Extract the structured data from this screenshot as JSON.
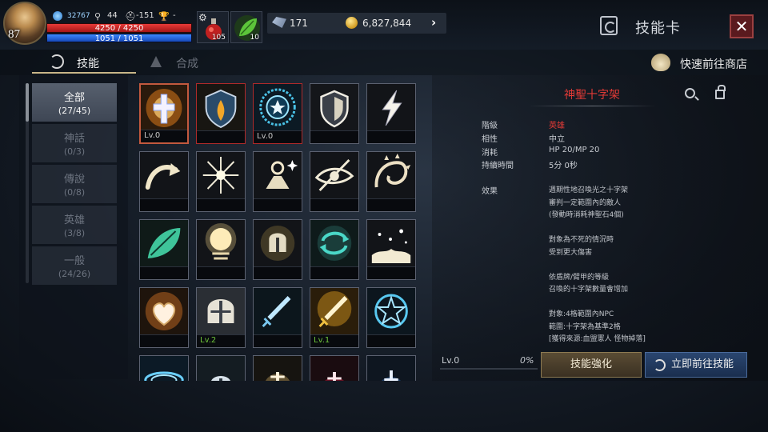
{
  "player": {
    "level": "87",
    "combat_power": "32767",
    "stat_a": "44",
    "stat_b": "-151",
    "stat_c": "-",
    "hp_text": "4250 / 4250",
    "mp_text": "1051 / 1051",
    "hp_fraction": 1.0,
    "mp_fraction": 1.0
  },
  "quick_slots": {
    "potion_count": "105",
    "leaf_count": "10"
  },
  "currency": {
    "crystal": "171",
    "gold": "6,827,844"
  },
  "header": {
    "title": "技能卡",
    "close_label": "✕"
  },
  "tabs": {
    "skill": "技能",
    "compose": "合成",
    "shop": "快速前往商店"
  },
  "categories": [
    {
      "name": "全部",
      "count": "(27/45)",
      "active": true
    },
    {
      "name": "神話",
      "count": "(0/3)",
      "active": false
    },
    {
      "name": "傳說",
      "count": "(0/8)",
      "active": false
    },
    {
      "name": "英雄",
      "count": "(3/8)",
      "active": false
    },
    {
      "name": "一般",
      "count": "(24/26)",
      "active": false
    }
  ],
  "skills": [
    {
      "icon": "holy-cross-icon",
      "level": "Lv.0",
      "border": "selected",
      "level_color": "#c8c8c8"
    },
    {
      "icon": "fire-shield-icon",
      "level": "",
      "border": "red",
      "level_color": "#c8c8c8"
    },
    {
      "icon": "star-ring-icon",
      "level": "Lv.0",
      "border": "red",
      "level_color": "#c8c8c8"
    },
    {
      "icon": "shield-icon",
      "level": "",
      "border": "normal",
      "level_color": "#c8c8c8"
    },
    {
      "icon": "lightning-icon",
      "level": "",
      "border": "normal",
      "level_color": "#c8c8c8"
    },
    {
      "icon": "curved-arrow-icon",
      "level": "",
      "border": "normal",
      "level_color": "#c8c8c8"
    },
    {
      "icon": "burst-icon",
      "level": "",
      "border": "normal",
      "level_color": "#c8c8c8"
    },
    {
      "icon": "sparkle-pyramid-icon",
      "level": "",
      "border": "normal",
      "level_color": "#c8c8c8"
    },
    {
      "icon": "eye-slash-icon",
      "level": "",
      "border": "normal",
      "level_color": "#c8c8c8"
    },
    {
      "icon": "thorn-dragon-icon",
      "level": "",
      "border": "normal",
      "level_color": "#c8c8c8"
    },
    {
      "icon": "green-leaf-icon",
      "level": "",
      "border": "normal",
      "level_color": "#c8c8c8"
    },
    {
      "icon": "light-orb-icon",
      "level": "",
      "border": "normal",
      "level_color": "#c8c8c8"
    },
    {
      "icon": "helmet-glow-icon",
      "level": "",
      "border": "normal",
      "level_color": "#c8c8c8"
    },
    {
      "icon": "cycle-arrows-icon",
      "level": "",
      "border": "normal",
      "level_color": "#c8c8c8"
    },
    {
      "icon": "sparkle-ground-icon",
      "level": "",
      "border": "normal",
      "level_color": "#c8c8c8"
    },
    {
      "icon": "heart-icon",
      "level": "",
      "border": "normal",
      "level_color": "#c8c8c8"
    },
    {
      "icon": "knight-helmet-icon",
      "level": "Lv.2",
      "border": "normal",
      "level_color": "#6ec43a"
    },
    {
      "icon": "blue-sword-icon",
      "level": "",
      "border": "normal",
      "level_color": "#c8c8c8"
    },
    {
      "icon": "golden-sword-icon",
      "level": "Lv.1",
      "border": "normal",
      "level_color": "#6ec43a"
    },
    {
      "icon": "blue-star-ring-icon",
      "level": "",
      "border": "normal",
      "level_color": "#c8c8c8"
    },
    {
      "icon": "whirlwind-icon",
      "level": "",
      "border": "normal",
      "level_color": "#c8c8c8"
    },
    {
      "icon": "helmet-shield-icon",
      "level": "",
      "border": "normal",
      "level_color": "#c8c8c8"
    },
    {
      "icon": "sword-flash-icon",
      "level": "",
      "border": "normal",
      "level_color": "#c8c8c8"
    },
    {
      "icon": "red-sword-icon",
      "level": "",
      "border": "normal",
      "level_color": "#c8c8c8"
    },
    {
      "icon": "blue-cross-icon",
      "level": "",
      "border": "normal",
      "level_color": "#c8c8c8"
    }
  ],
  "detail": {
    "name": "神聖十字架",
    "props": [
      {
        "label": "階級",
        "value": "英雄",
        "red": true
      },
      {
        "label": "相性",
        "value": "中立",
        "red": false
      },
      {
        "label": "消耗",
        "value": "HP 20/MP 20",
        "red": false
      },
      {
        "label": "持續時間",
        "value": "5分 0秒",
        "red": false
      }
    ],
    "effect_label": "效果",
    "description": [
      "週期性地召喚光之十字架",
      "審判一定範圍內的敵人",
      "(發動時消耗神聖石4個)",
      "",
      "對象為不死的情況時",
      "受到更大傷害",
      "",
      "依盾牌/臂甲的等級",
      "召喚的十字架數量會增加",
      "",
      "對象:4格範圍內NPC",
      "範圍:十字架為基準2格",
      "[獲得來源:血盟憲人 怪物掉落]"
    ],
    "level": "Lv.0",
    "progress": "0%",
    "progress_fraction": 0.0,
    "enhance_label": "技能強化",
    "goto_label": "立即前往技能"
  }
}
